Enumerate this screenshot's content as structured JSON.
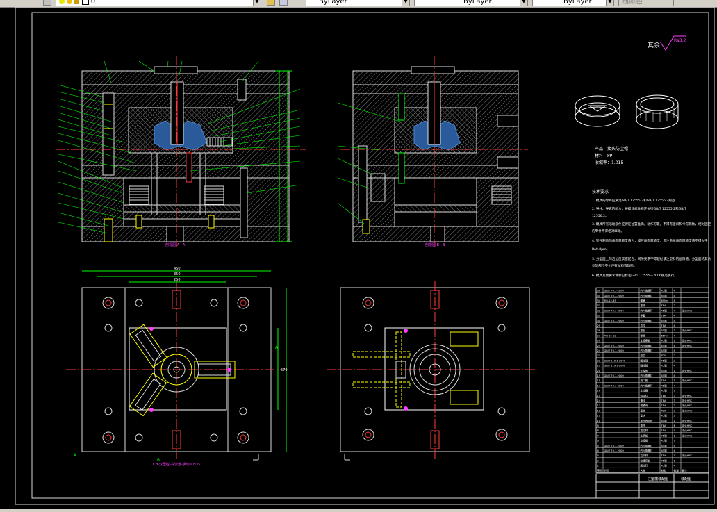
{
  "toolbar": {
    "layer_value": "0",
    "color_value": "ByLayer",
    "linetype_value": "ByLayer",
    "lineweight_value": "ByLayer",
    "plotstyle_value": "随颜色"
  },
  "icons": {
    "layer": "layer-stack-icon",
    "bulb": "lightbulb-icon",
    "sun": "freeze-sun-icon",
    "lock": "lock-icon",
    "color": "color-square-icon",
    "dropdown": "chevron-down-icon",
    "layer_tools": "layer-tools-icon"
  },
  "drawing": {
    "roughness_label": "其余",
    "roughness_value": "Ra3.2",
    "section_aa": "剖视图 A—A",
    "section_bb": "剖视图 B—B",
    "part_name": "产品：接头防尘帽",
    "material": "材料：PP",
    "shrinkage": "收缩率：1.015",
    "tech_title": "技术要求",
    "notes": [
      "1. 模具的零件应满足GB/T 12555.2和GB/T 12556.2规范",
      "2. 导柱、导套的配合，按模具标准规定执行GB/T 12555.2和GB/T",
      "12556.2。",
      "3. 模具所有活动部件应保证位置准确，动作可靠，不得有歪斜和卡滞现象，相对固定",
      "的零件不得相对窜动。",
      "4. 塑件制品的表面粗糙度值为，模腔表面粗糙度，浇注系统表面粗糙度值不得大于",
      "Ra0.8μm。",
      "5. 分型面上的沿边应紧密配合，间隙要求不得超过该注塑料的溢料值。分型面的其余",
      "处等部位不允许有溢料等缺陷。",
      "6. 模具其他要求请参见标准GB/T 12555—2006规范执行。"
    ],
    "dim_650": "450",
    "dim_300": "350",
    "dim_250": "250",
    "dim_570": "570",
    "label_A": "A",
    "label_B": "B",
    "view_caption": "CH-双型腔-冷流道-手动-CH35",
    "title_block": "注塑模装配图",
    "title_school": "装配图",
    "bom_rows": [
      {
        "no": "36",
        "std": "GB/T 70.1-2000",
        "name": "内六角螺钉",
        "mat": "45钢",
        "qty": "4",
        "note": ""
      },
      {
        "no": "35",
        "std": "GB/T 70.1-2000",
        "name": "内六角螺钉",
        "mat": "45钢",
        "qty": "4",
        "note": ""
      },
      {
        "no": "34",
        "std": "M5-12-35",
        "name": "弹簧",
        "mat": "65Mn",
        "qty": "4",
        "note": ""
      },
      {
        "no": "33",
        "std": "",
        "name": "推杆",
        "mat": "T8A",
        "qty": "2",
        "note": ""
      },
      {
        "no": "32",
        "std": "GB/T 70.1-2000",
        "name": "内六角螺钉",
        "mat": "45钢",
        "qty": "4",
        "note": "淬火HRC"
      },
      {
        "no": "31",
        "std": "",
        "name": "导套",
        "mat": "T8A",
        "qty": "4",
        "note": ""
      },
      {
        "no": "30",
        "std": "GB/T 70.1-2000",
        "name": "内六角螺钉",
        "mat": "45钢",
        "qty": "4",
        "note": ""
      },
      {
        "no": "29",
        "std": "",
        "name": "导柱",
        "mat": "T8A",
        "qty": "4",
        "note": ""
      },
      {
        "no": "28",
        "std": "",
        "name": "推板",
        "mat": "45钢",
        "qty": "1",
        "note": "淬火HRC"
      },
      {
        "no": "27",
        "std": "M8-25-12",
        "name": "弹簧",
        "mat": "65Mn",
        "qty": "4",
        "note": ""
      },
      {
        "no": "26",
        "std": "",
        "name": "定模座板",
        "mat": "45钢",
        "qty": "1",
        "note": "淬火HRC"
      },
      {
        "no": "25",
        "std": "GB/T 70.1-2000",
        "name": "内六角螺钉",
        "mat": "45钢",
        "qty": "4",
        "note": "淬火HRC"
      },
      {
        "no": "24",
        "std": "GB/T 70.1-2000",
        "name": "内六角螺钉",
        "mat": "45钢",
        "qty": "4",
        "note": ""
      },
      {
        "no": "23",
        "std": "",
        "name": "型芯",
        "mat": "P20",
        "qty": "2",
        "note": ""
      },
      {
        "no": "22",
        "std": "GB/T 119.1-2000",
        "name": "圆柱销",
        "mat": "45钢",
        "qty": "2",
        "note": ""
      },
      {
        "no": "21",
        "std": "GB/T 119.1-2000",
        "name": "圆柱销",
        "mat": "45钢",
        "qty": "4",
        "note": ""
      },
      {
        "no": "20",
        "std": "",
        "name": "定模板",
        "mat": "45钢",
        "qty": "1",
        "note": "淬火HRC"
      },
      {
        "no": "19",
        "std": "GB/T 70.1-2000",
        "name": "内六角螺钉",
        "mat": "45钢",
        "qty": "4",
        "note": ""
      },
      {
        "no": "18",
        "std": "",
        "name": "浇口套",
        "mat": "T8A",
        "qty": "1",
        "note": "淬火HRC"
      },
      {
        "no": "17",
        "std": "GB/T 70.1-2000",
        "name": "内六角螺钉",
        "mat": "45钢",
        "qty": "4",
        "note": ""
      },
      {
        "no": "16",
        "std": "",
        "name": "定位圈",
        "mat": "45钢",
        "qty": "1",
        "note": ""
      },
      {
        "no": "15",
        "std": "",
        "name": "斜导柱",
        "mat": "T8A",
        "qty": "3",
        "note": "淬火HRC"
      },
      {
        "no": "14",
        "std": "",
        "name": "滑块",
        "mat": "T8A",
        "qty": "3",
        "note": "淬火HRC"
      },
      {
        "no": "13",
        "std": "",
        "name": "楔紧块",
        "mat": "T8A",
        "qty": "3",
        "note": "淬火HRC"
      },
      {
        "no": "12",
        "std": "",
        "name": "型腔",
        "mat": "P20",
        "qty": "2",
        "note": "淬火HRC"
      },
      {
        "no": "11",
        "std": "",
        "name": "垫块",
        "mat": "45钢",
        "qty": "2",
        "note": ""
      },
      {
        "no": "10",
        "std": "",
        "name": "推杆固定板",
        "mat": "45钢",
        "qty": "1",
        "note": "淬火HRC"
      },
      {
        "no": "9",
        "std": "",
        "name": "推杆",
        "mat": "T8A",
        "qty": "6",
        "note": "淬火HRC"
      },
      {
        "no": "8",
        "std": "",
        "name": "复位杆",
        "mat": "T8A",
        "qty": "4",
        "note": "淬火HRC"
      },
      {
        "no": "7",
        "std": "",
        "name": "支承板",
        "mat": "45钢",
        "qty": "1",
        "note": "淬火HRC"
      },
      {
        "no": "6",
        "std": "",
        "name": "动模板",
        "mat": "45钢",
        "qty": "1",
        "note": ""
      },
      {
        "no": "5",
        "std": "GB/T 70.1-2000",
        "name": "内六角螺钉",
        "mat": "45钢",
        "qty": "4",
        "note": ""
      },
      {
        "no": "4",
        "std": "GB/T 70.1-2000",
        "name": "内六角螺钉",
        "mat": "45钢",
        "qty": "4",
        "note": ""
      },
      {
        "no": "3",
        "std": "",
        "name": "拉料杆",
        "mat": "T8A",
        "qty": "1",
        "note": "淬火HRC"
      },
      {
        "no": "2",
        "std": "",
        "name": "动模座板",
        "mat": "45钢",
        "qty": "1",
        "note": ""
      },
      {
        "no": "1",
        "std": "",
        "name": "限位钉",
        "mat": "45钢",
        "qty": "4",
        "note": ""
      }
    ],
    "bom_header": {
      "no": "序号",
      "std": "代号",
      "name": "名称",
      "qty": "数量",
      "mat": "材料",
      "note": "备注"
    }
  }
}
